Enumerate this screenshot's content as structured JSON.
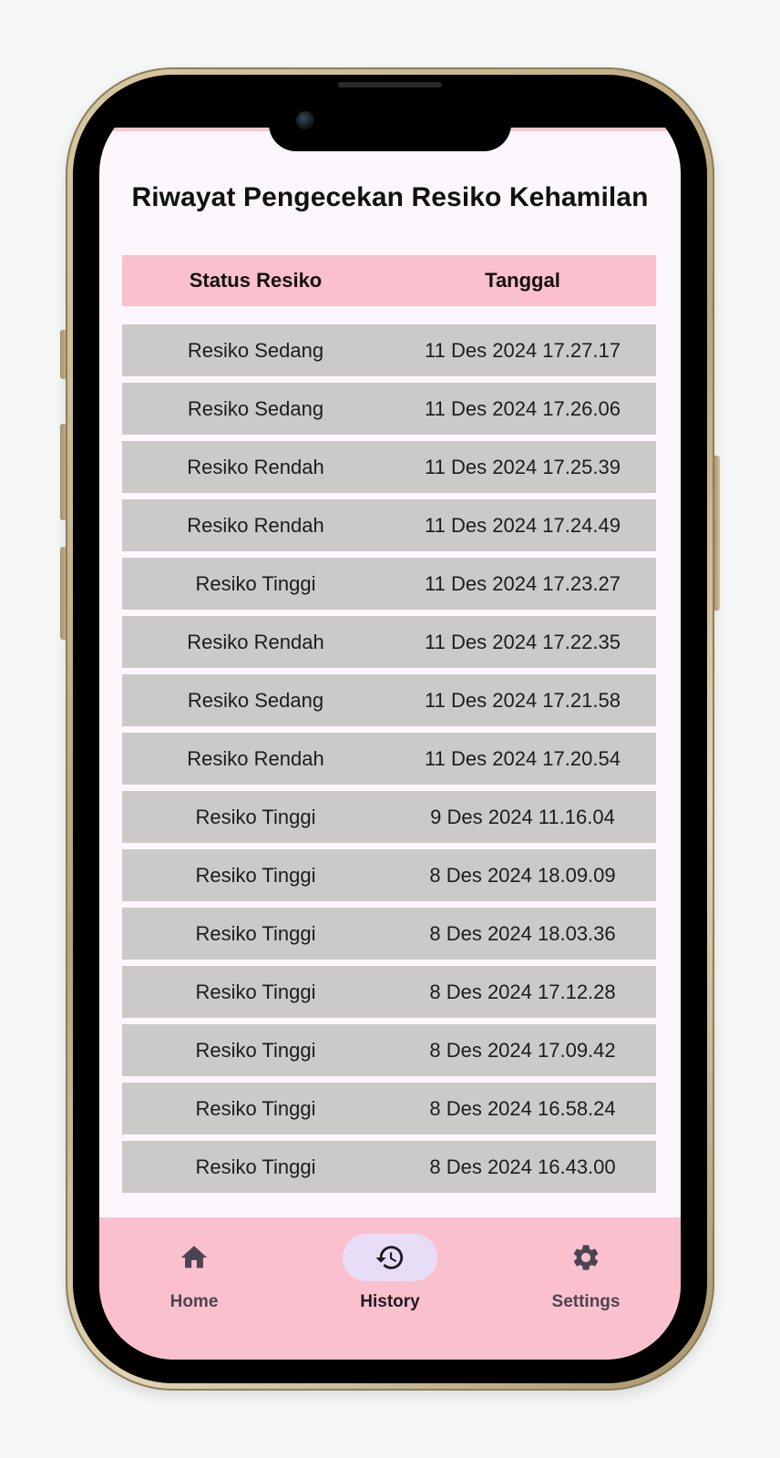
{
  "page": {
    "title": "Riwayat Pengecekan Resiko Kehamilan"
  },
  "table": {
    "headers": [
      "Status Resiko",
      "Tanggal"
    ],
    "rows": [
      {
        "status": "Resiko Sedang",
        "date": "11 Des 2024 17.27.17"
      },
      {
        "status": "Resiko Sedang",
        "date": "11 Des 2024 17.26.06"
      },
      {
        "status": "Resiko Rendah",
        "date": "11 Des 2024 17.25.39"
      },
      {
        "status": "Resiko Rendah",
        "date": "11 Des 2024 17.24.49"
      },
      {
        "status": "Resiko Tinggi",
        "date": "11 Des 2024 17.23.27"
      },
      {
        "status": "Resiko Rendah",
        "date": "11 Des 2024 17.22.35"
      },
      {
        "status": "Resiko Sedang",
        "date": "11 Des 2024 17.21.58"
      },
      {
        "status": "Resiko Rendah",
        "date": "11 Des 2024 17.20.54"
      },
      {
        "status": "Resiko Tinggi",
        "date": "9 Des 2024 11.16.04"
      },
      {
        "status": "Resiko Tinggi",
        "date": "8 Des 2024 18.09.09"
      },
      {
        "status": "Resiko Tinggi",
        "date": "8 Des 2024 18.03.36"
      },
      {
        "status": "Resiko Tinggi",
        "date": "8 Des 2024 17.12.28"
      },
      {
        "status": "Resiko Tinggi",
        "date": "8 Des 2024 17.09.42"
      },
      {
        "status": "Resiko Tinggi",
        "date": "8 Des 2024 16.58.24"
      },
      {
        "status": "Resiko Tinggi",
        "date": "8 Des 2024 16.43.00"
      },
      {
        "status": "",
        "date": ""
      }
    ]
  },
  "nav": {
    "items": [
      {
        "label": "Home",
        "icon": "home-icon",
        "active": false
      },
      {
        "label": "History",
        "icon": "history-icon",
        "active": true
      },
      {
        "label": "Settings",
        "icon": "gear-icon",
        "active": false
      }
    ]
  },
  "colors": {
    "header_bg": "#fbc0cd",
    "row_bg": "#cbcac9",
    "nav_bg": "#fbc0cd",
    "active_pill": "#e8ddf6",
    "screen_bg": "#fdf7fd"
  }
}
